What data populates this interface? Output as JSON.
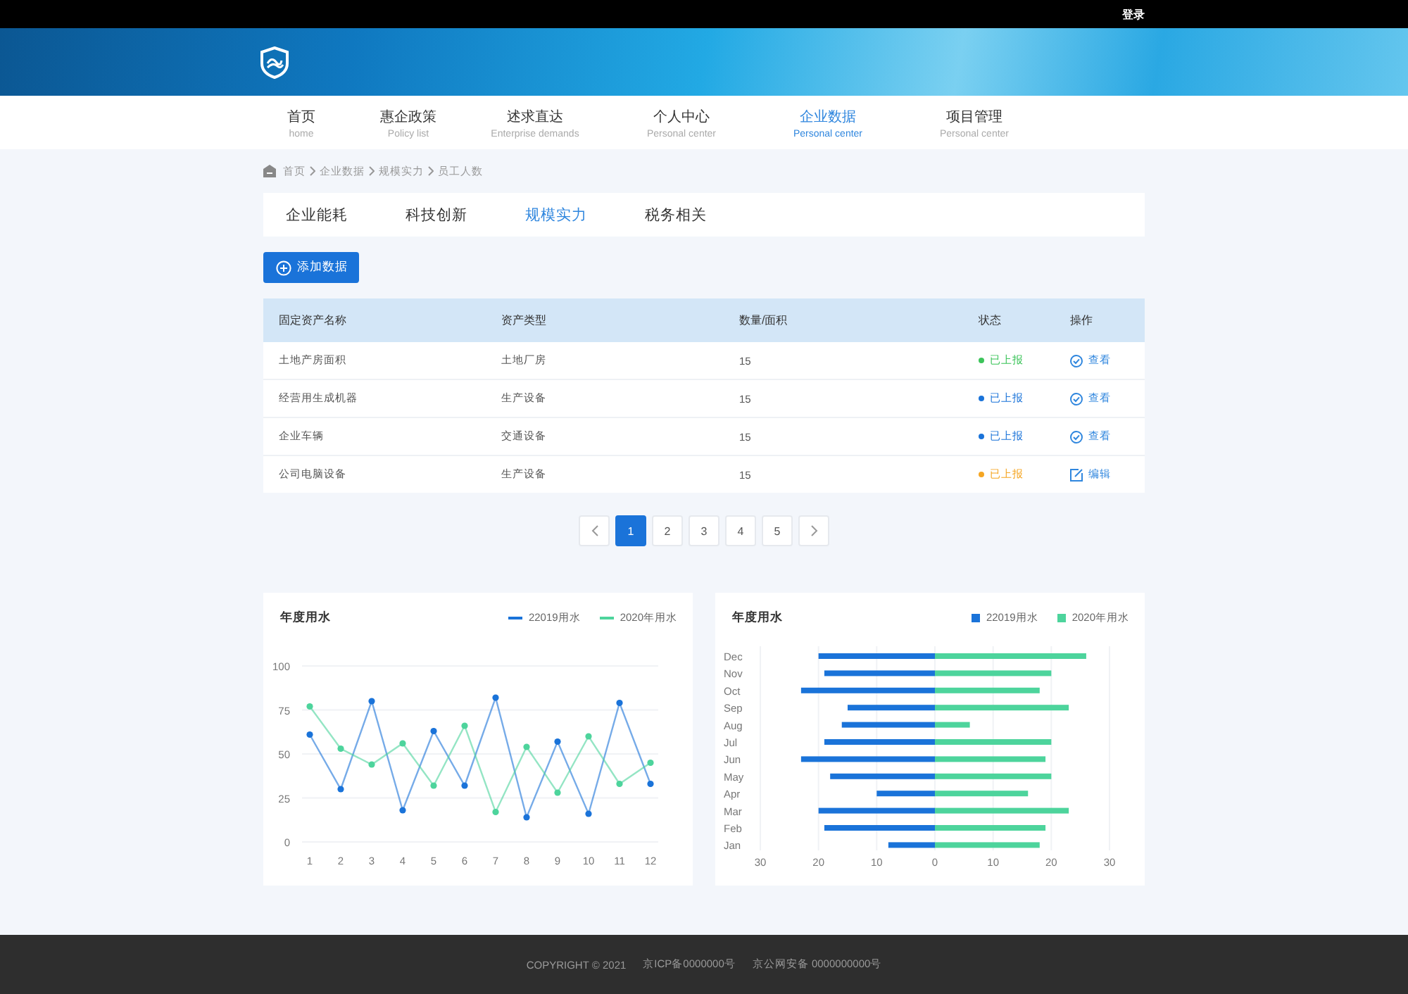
{
  "top_bar": {
    "login": "登录"
  },
  "nav": [
    {
      "label": "首页",
      "sublabel": "home",
      "selected": false
    },
    {
      "label": "惠企政策",
      "sublabel": "Policy list",
      "selected": false
    },
    {
      "label": "述求直达",
      "sublabel": "Enterprise demands",
      "selected": false
    },
    {
      "label": "个人中心",
      "sublabel": "Personal center",
      "selected": false
    },
    {
      "label": "企业数据",
      "sublabel": "Personal center",
      "selected": true
    },
    {
      "label": "项目管理",
      "sublabel": "Personal center",
      "selected": false
    }
  ],
  "breadcrumb": [
    "首页",
    "企业数据",
    "规模实力",
    "员工人数"
  ],
  "tabs": [
    {
      "label": "企业能耗",
      "selected": false
    },
    {
      "label": "科技创新",
      "selected": false
    },
    {
      "label": "规模实力",
      "selected": true
    },
    {
      "label": "税务相关",
      "selected": false
    }
  ],
  "add_button": "添加数据",
  "table": {
    "columns": [
      "固定资产名称",
      "资产类型",
      "数量/面积",
      "状态",
      "操作"
    ],
    "rows": [
      {
        "name": "土地产房面积",
        "type": "土地厂房",
        "amount": "15",
        "status": "已上报",
        "color": "#3cc45a",
        "action": {
          "kind": "view",
          "label": "查看"
        }
      },
      {
        "name": "经营用生成机器",
        "type": "生产设备",
        "amount": "15",
        "status": "已上报",
        "color": "#1a73d9",
        "action": {
          "kind": "view",
          "label": "查看"
        }
      },
      {
        "name": "企业车辆",
        "type": "交通设备",
        "amount": "15",
        "status": "已上报",
        "color": "#1a73d9",
        "action": {
          "kind": "view",
          "label": "查看"
        }
      },
      {
        "name": "公司电脑设备",
        "type": "生产设备",
        "amount": "15",
        "status": "已上报",
        "color": "#f5a623",
        "action": {
          "kind": "edit",
          "label": "编辑"
        }
      }
    ]
  },
  "pagination": {
    "pages": [
      {
        "label": "1",
        "selected": true
      },
      {
        "label": "2",
        "selected": false
      },
      {
        "label": "3",
        "selected": false
      },
      {
        "label": "4",
        "selected": false
      },
      {
        "label": "5",
        "selected": false
      }
    ]
  },
  "charts": [
    {
      "chart_data": {
        "type": "line",
        "title": "年度用水",
        "x": [
          1,
          2,
          3,
          4,
          5,
          6,
          7,
          8,
          9,
          10,
          11,
          12
        ],
        "xlim": [
          0.75,
          12.25
        ],
        "ylim": [
          0,
          100
        ],
        "yticks": [
          0,
          25,
          50,
          75,
          100
        ],
        "xticks": [
          1,
          2,
          3,
          4,
          5,
          6,
          7,
          8,
          9,
          10,
          11,
          12
        ],
        "grid": true,
        "legend": true,
        "series": [
          {
            "name": "22019用水",
            "color": "#1a73d9",
            "marker": "circle",
            "values": [
              61,
              30,
              80,
              18,
              63,
              32,
              82,
              14,
              57,
              16,
              79,
              33
            ]
          },
          {
            "name": "2020年用水",
            "color": "#4dd49c",
            "marker": "circle",
            "values": [
              77,
              53,
              44,
              56,
              32,
              66,
              17,
              54,
              28,
              60,
              33,
              45
            ]
          }
        ]
      }
    },
    {
      "chart_data": {
        "type": "bar",
        "orientation": "horizontal",
        "title": "年度用水",
        "categories": [
          "Dec",
          "Nov",
          "Oct",
          "Sep",
          "Aug",
          "Jul",
          "Jun",
          "May",
          "Apr",
          "Mar",
          "Feb",
          "Jan"
        ],
        "xlim": [
          -30,
          30
        ],
        "stacked": true,
        "grid": true,
        "legend": true,
        "xticks": [
          {
            "value": -30,
            "label": "30"
          },
          {
            "value": -20,
            "label": "20"
          },
          {
            "value": -10,
            "label": "10"
          },
          {
            "value": 0,
            "label": "0"
          },
          {
            "value": 10,
            "label": "10"
          },
          {
            "value": 20,
            "label": "20"
          },
          {
            "value": 30,
            "label": "30"
          }
        ],
        "series": [
          {
            "name": "22019用水",
            "color": "#1a73d9",
            "values": [
              -20,
              -19,
              -23,
              -15,
              -16,
              -19,
              -23,
              -18,
              -10,
              -20,
              -19,
              -8
            ]
          },
          {
            "name": "2020年用水",
            "color": "#4dd49c",
            "values": [
              26,
              20,
              18,
              23,
              6,
              20,
              19,
              20,
              16,
              23,
              19,
              18
            ]
          }
        ]
      }
    }
  ],
  "footer": [
    "COPYRIGHT © 2021",
    "京ICP备0000000号",
    "京公网安备 0000000000号"
  ]
}
